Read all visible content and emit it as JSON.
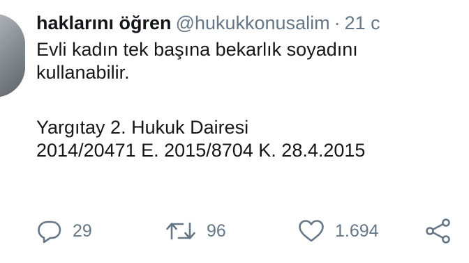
{
  "tweet": {
    "author_name": "haklarını öğren",
    "author_handle": "@hukukkonusalim",
    "separator": "·",
    "timestamp": "21 c",
    "text_lines": [
      "Evli kadın tek başına bekarlık soyadını",
      "kullanabilir."
    ],
    "citation_lines": [
      "Yargıtay 2. Hukuk Dairesi",
      "2014/20471 E. 2015/8704 K. 28.4.2015"
    ]
  },
  "actions": {
    "reply": {
      "icon": "reply-icon",
      "count": "29"
    },
    "retweet": {
      "icon": "retweet-icon",
      "count": "96"
    },
    "like": {
      "icon": "heart-icon",
      "count": "1.694"
    },
    "share": {
      "icon": "share-icon"
    }
  },
  "colors": {
    "text": "#14171a",
    "secondary": "#657786",
    "background": "#ffffff"
  }
}
